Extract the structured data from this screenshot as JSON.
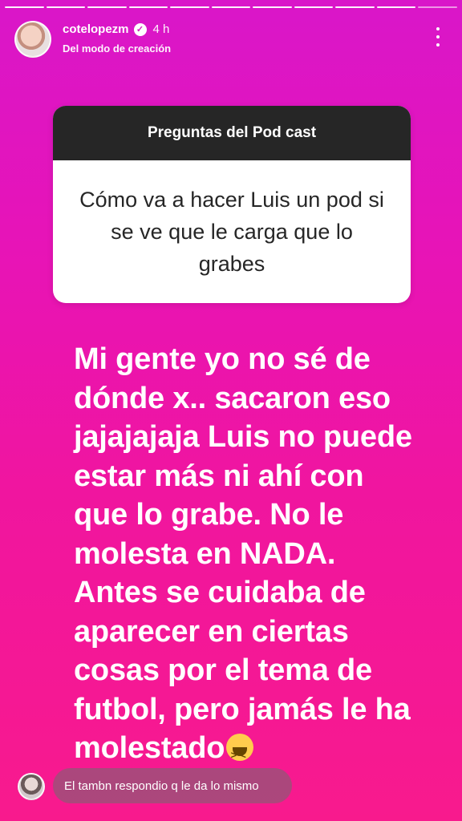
{
  "story": {
    "segments_total": 11,
    "segments_done": 10,
    "username": "cotelopezm",
    "time_ago": "4 h",
    "subtitle": "Del modo de creación",
    "verified_icon": "verified-badge-icon",
    "menu_icon": "more-vertical-icon"
  },
  "question": {
    "title": "Preguntas del Pod cast",
    "text": "Cómo va a hacer Luis un pod si se ve que le carga que lo grabes"
  },
  "answer": {
    "text": "Mi gente yo no sé de dónde x.. sacaron eso jajajajaja Luis no puede estar más ni ahí con que lo grabe. No le molesta en NADA. Antes se cuidaba de aparecer en ciertas cosas por el tema de futbol, pero jamás le ha molestado",
    "emoji_icon": "grinning-squinting-face-icon"
  },
  "reply": {
    "text": "El tambn respondio q le da lo mismo"
  },
  "colors": {
    "gradient_top": "#d916c9",
    "gradient_bottom": "#f81a8d",
    "question_header": "#262626"
  }
}
